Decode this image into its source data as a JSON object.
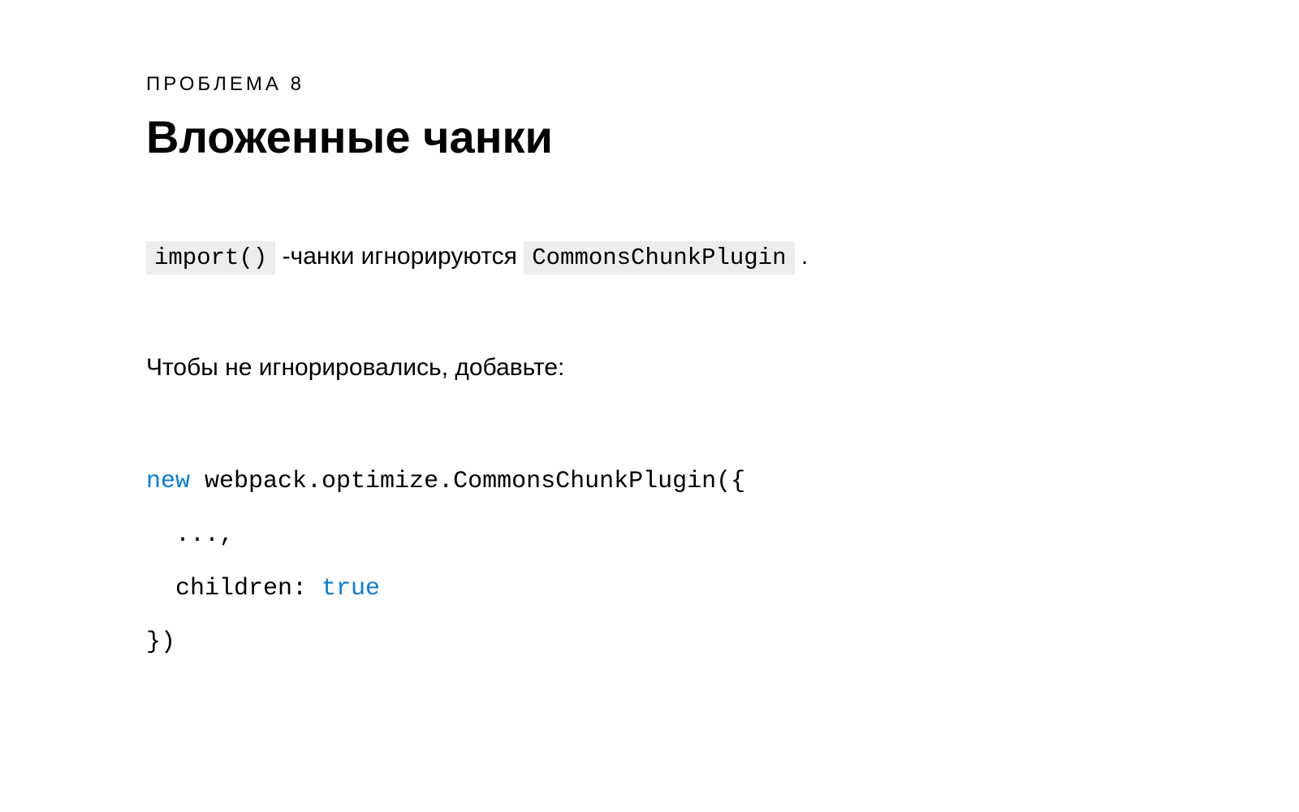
{
  "slide": {
    "eyebrow": "ПРОБЛЕМА 8",
    "title": "Вложенные чанки",
    "sentence1": {
      "code1": "import()",
      "text1": " -чанки игнорируются ",
      "code2": "CommonsChunkPlugin",
      "text2": " ."
    },
    "sentence2": "Чтобы не игнорировались, добавьте:",
    "code": {
      "line1_kw": "new",
      "line1_rest": " webpack.optimize.CommonsChunkPlugin({",
      "line2": "  ...,",
      "line3_key": "  children: ",
      "line3_val": "true",
      "line4": "})"
    }
  }
}
